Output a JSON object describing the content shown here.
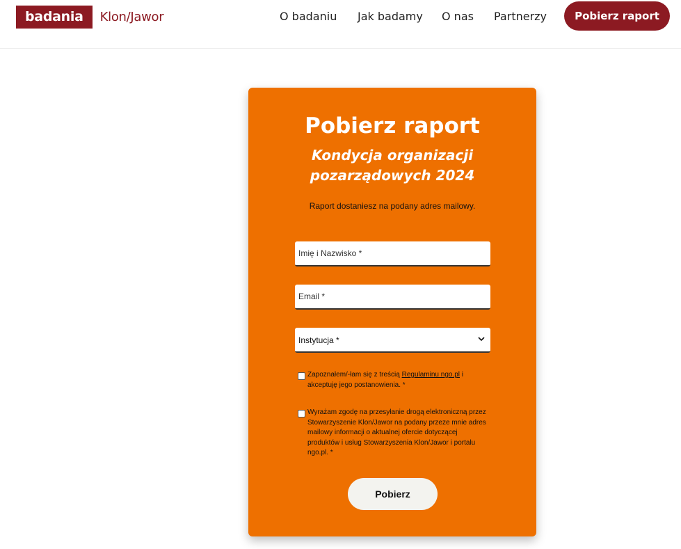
{
  "header": {
    "logo_badge": "badania",
    "logo_text": "Klon/Jawor",
    "nav": [
      {
        "label": "O badaniu"
      },
      {
        "label": "Jak badamy"
      },
      {
        "label": "O nas"
      },
      {
        "label": "Partnerzy"
      }
    ],
    "cta_label": "Pobierz raport"
  },
  "form": {
    "title": "Pobierz raport",
    "subtitle_line1": "Kondycja organizacji",
    "subtitle_line2": "pozarządowych 2024",
    "note": "Raport dostaniesz na podany adres mailowy.",
    "name_placeholder": "Imię i Nazwisko *",
    "email_placeholder": "Email *",
    "institution_label": "Instytucja *",
    "consent1_before": "Zapoznałem/-łam się z treścią ",
    "consent1_link": "Regulaminu ngo.pl",
    "consent1_after": " i akceptuję jego postanowienia. *",
    "consent2": "Wyrażam zgodę na przesyłanie drogą elektroniczną przez Stowarzyszenie Klon/Jawor na podany przeze mnie adres mailowy informacji o aktualnej ofercie dotyczącej produktów i usług Stowarzyszenia Klon/Jawor i portalu ngo.pl. *",
    "submit_label": "Pobierz"
  },
  "colors": {
    "brand": "#8c1a22",
    "card": "#ee7000",
    "submit_bg": "#f3f3ef"
  }
}
